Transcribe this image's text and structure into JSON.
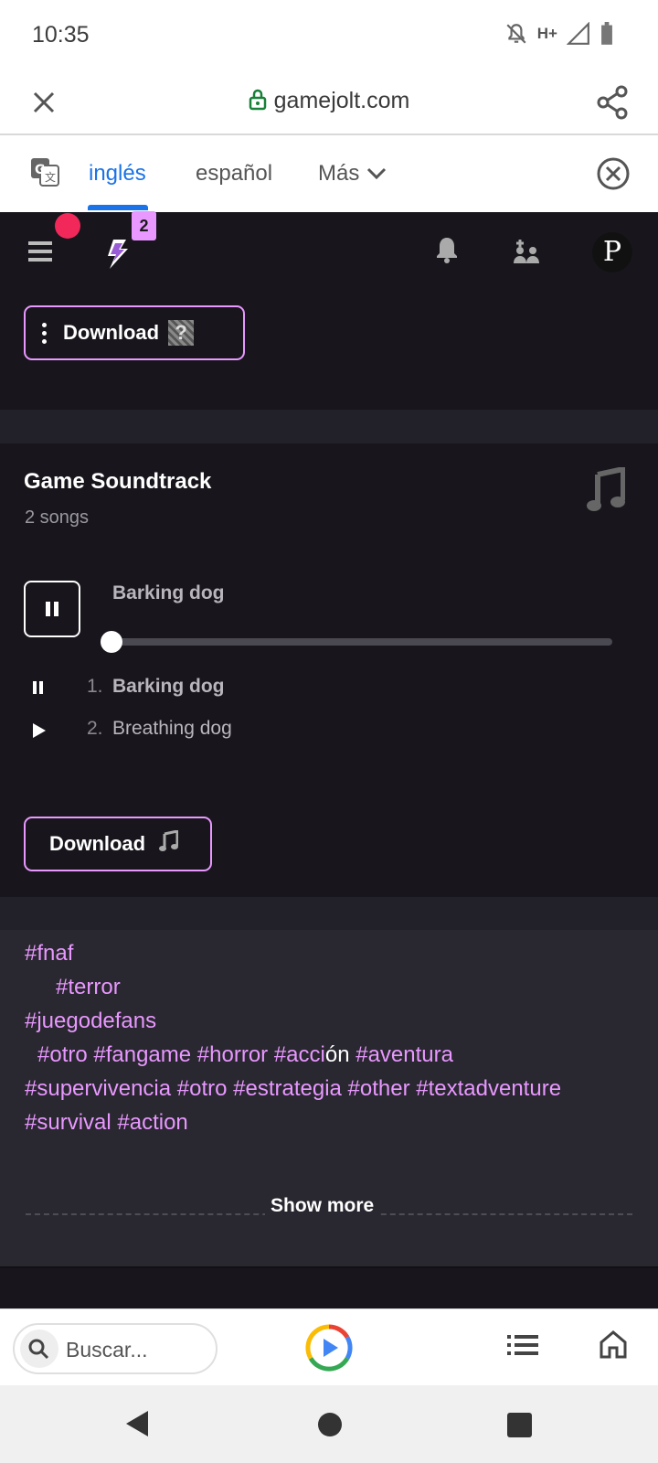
{
  "status_bar": {
    "time": "10:35",
    "network": "H+"
  },
  "browser": {
    "url": "gamejolt.com"
  },
  "translate_bar": {
    "languages": [
      "inglés",
      "español"
    ],
    "more_label": "Más"
  },
  "site_header": {
    "notification_count": "2",
    "avatar_letter": "P"
  },
  "download_top": {
    "label": "Download"
  },
  "soundtrack": {
    "title": "Game Soundtrack",
    "subtitle": "2 songs",
    "now_playing": "Barking dog",
    "progress": 0,
    "songs": [
      {
        "number": "1.",
        "name": "Barking dog",
        "state": "playing"
      },
      {
        "number": "2.",
        "name": "Breathing dog",
        "state": "paused"
      }
    ],
    "download_label": "Download"
  },
  "tags": {
    "line1": "#fnaf",
    "line2": "#terror",
    "line3": "#juegodefans",
    "line4a": "#otro #fangame #horror #acci",
    "line4b": "ón",
    "line4c": " #aventura",
    "line5": "#supervivencia #otro #estrategia #other #textadventure",
    "line6": "#survival #action",
    "show_more": "Show more"
  },
  "bottom_bar": {
    "search_placeholder": "Buscar..."
  },
  "colors": {
    "accent": "#e898ff",
    "link_blue": "#1a73e8",
    "red_dot": "#f2285a"
  }
}
